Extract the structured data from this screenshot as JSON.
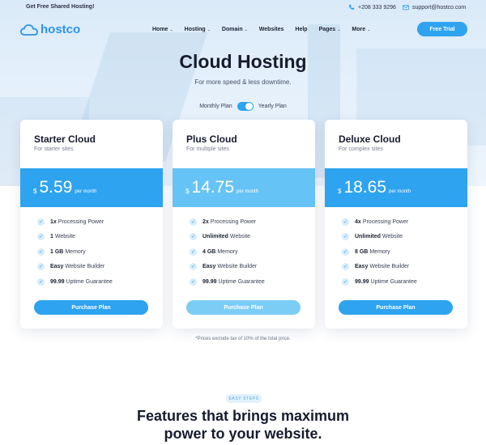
{
  "topbar": {
    "promo": "Get Free Shared Hosting!",
    "phone": "+208 333 9296",
    "email": "support@hostco.com"
  },
  "brand": {
    "name": "hostco",
    "accent": "#2ea3ef"
  },
  "nav": {
    "items": [
      {
        "label": "Home",
        "has_dropdown": true
      },
      {
        "label": "Hosting",
        "has_dropdown": true
      },
      {
        "label": "Domain",
        "has_dropdown": true
      },
      {
        "label": "Websites",
        "has_dropdown": false
      },
      {
        "label": "Help",
        "has_dropdown": false
      },
      {
        "label": "Pages",
        "has_dropdown": true
      },
      {
        "label": "More",
        "has_dropdown": true
      }
    ],
    "cta": "Free Trial"
  },
  "hero": {
    "title": "Cloud Hosting",
    "subtitle": "For more speed & less downtime."
  },
  "plan_toggle": {
    "left_label": "Monthly Plan",
    "right_label": "Yearly Plan",
    "selected": "Yearly Plan"
  },
  "plans": [
    {
      "name": "Starter Cloud",
      "description": "For starter sites",
      "currency": "$",
      "price": "5.59",
      "period": "per month",
      "features": [
        {
          "strong": "1x",
          "text": "Processing Power"
        },
        {
          "strong": "1",
          "text": "Website"
        },
        {
          "strong": "1 GB",
          "text": "Memory"
        },
        {
          "strong": "Easy",
          "text": "Website Builder"
        },
        {
          "strong": "99.99",
          "text": "Uptime Guarantee"
        }
      ],
      "button": "Purchase Plan"
    },
    {
      "name": "Plus Cloud",
      "description": "For multiple sites",
      "currency": "$",
      "price": "14.75",
      "period": "per month",
      "features": [
        {
          "strong": "2x",
          "text": "Processing Power"
        },
        {
          "strong": "Unlimited",
          "text": "Website"
        },
        {
          "strong": "4 GB",
          "text": "Memory"
        },
        {
          "strong": "Easy",
          "text": "Website Builder"
        },
        {
          "strong": "99.99",
          "text": "Uptime Guarantee"
        }
      ],
      "button": "Purchase Plan"
    },
    {
      "name": "Deluxe Cloud",
      "description": "For complex sites",
      "currency": "$",
      "price": "18.65",
      "period": "per month",
      "features": [
        {
          "strong": "4x",
          "text": "Processing Power"
        },
        {
          "strong": "Unlimited",
          "text": "Website"
        },
        {
          "strong": "8 GB",
          "text": "Memory"
        },
        {
          "strong": "Easy",
          "text": "Website Builder"
        },
        {
          "strong": "99.99",
          "text": "Uptime Guarantee"
        }
      ],
      "button": "Purchase Plan"
    }
  ],
  "price_note": "*Prices exclude tax of 10% of the total price.",
  "features_section": {
    "badge": "EASY STEPS",
    "title_line1": "Features that brings maximum",
    "title_line2": "power to your website."
  }
}
